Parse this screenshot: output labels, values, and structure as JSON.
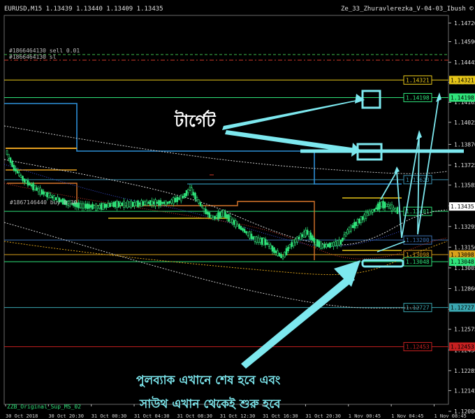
{
  "chart_data": {
    "type": "candlestick",
    "header": {
      "symbol_info": "EURUSD,M15  1.13439 1.13440 1.13409 1.13435",
      "indicator_name": "Ze_33_Zhuravlerezka_V-04-03_Ibush ©"
    },
    "y_ticks": [
      "1.14720",
      "1.14590",
      "1.14445",
      "1.14305",
      "1.14165",
      "1.14025",
      "1.13870",
      "1.13725",
      "1.13585",
      "1.13440",
      "1.13295",
      "1.13150",
      "1.13005",
      "1.12860",
      "1.12715",
      "1.12575",
      "1.12430",
      "1.12285",
      "1.12145",
      "1.12000"
    ],
    "ylim": [
      1.12,
      1.1472
    ],
    "x_ticks": [
      "30 Oct 2018",
      "30 Oct 20:30",
      "31 Oct 00:30",
      "31 Oct 04:30",
      "31 Oct 08:30",
      "31 Oct 12:30",
      "31 Oct 16:30",
      "31 Oct 20:30",
      "1 Nov 00:45",
      "1 Nov 04:45",
      "1 Nov 08:45"
    ],
    "order_labels": {
      "sell": "#1866464130 sell 0.01",
      "sl": "#1866464130 sl",
      "buy": "#1867146440 buy 0.30"
    },
    "levels": [
      {
        "label": "1.14321",
        "value": 1.14321,
        "color": "#e6c619",
        "line": "#e6c619"
      },
      {
        "label": "1.14198",
        "value": 1.14198,
        "color": "#2fe37a",
        "line": "#2fe37a"
      },
      {
        "label": "1.13623",
        "value": 1.13623,
        "color": "#3a8fb0",
        "line": "#3a8fb0"
      },
      {
        "label": "1.13401",
        "value": 1.13401,
        "color": "#2fe37a",
        "line": "#2fe37a"
      },
      {
        "label": "1.13200",
        "value": 1.132,
        "color": "#3a6fb0",
        "line": "#3a6fb0"
      },
      {
        "label": "1.13098",
        "value": 1.13098,
        "color": "#d9a11a",
        "line": "#d9a11a"
      },
      {
        "label": "1.13048",
        "value": 1.13048,
        "color": "#2fe37a",
        "line": "#2fe37a"
      },
      {
        "label": "1.12727",
        "value": 1.12727,
        "color": "#3aa6b0",
        "line": "#3aa6b0"
      },
      {
        "label": "1.12453",
        "value": 1.12453,
        "color": "#c62020",
        "line": "#c62020"
      }
    ],
    "current_price": {
      "label": "1.13435",
      "value": 1.13435
    },
    "annotations": {
      "target_text": "টার্গেট",
      "bottom_text_line1": "পুলব্যাক এখানে শেষ হবে এবং",
      "bottom_text_line2": "সাউথ এখান থেকেই শুরু হবে"
    },
    "watermark": "ZZB_Original_Sup_MS_02"
  },
  "colors": {
    "background": "#000000",
    "bull": "#2fe37a",
    "bear": "#2fe37a",
    "annotation": "#7de8ef"
  }
}
